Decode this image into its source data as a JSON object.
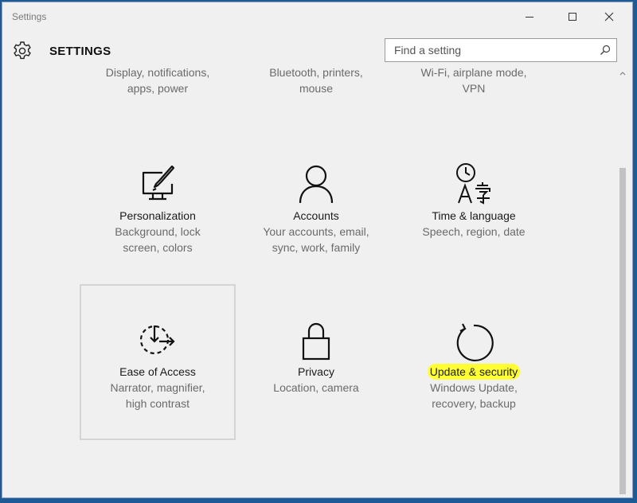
{
  "window": {
    "title": "Settings"
  },
  "header": {
    "title": "SETTINGS",
    "search_placeholder": "Find a setting"
  },
  "top_row": [
    {
      "desc1": "Display, notifications,",
      "desc2": "apps, power"
    },
    {
      "desc1": "Bluetooth, printers,",
      "desc2": "mouse"
    },
    {
      "desc1": "Wi-Fi, airplane mode,",
      "desc2": "VPN"
    }
  ],
  "tiles": [
    {
      "title": "Personalization",
      "desc1": "Background, lock",
      "desc2": "screen, colors",
      "icon": "personalization-icon"
    },
    {
      "title": "Accounts",
      "desc1": "Your accounts, email,",
      "desc2": "sync, work, family",
      "icon": "accounts-icon"
    },
    {
      "title": "Time & language",
      "desc1": "Speech, region, date",
      "desc2": "",
      "icon": "time-language-icon"
    },
    {
      "title": "Ease of Access",
      "desc1": "Narrator, magnifier,",
      "desc2": "high contrast",
      "icon": "ease-of-access-icon"
    },
    {
      "title": "Privacy",
      "desc1": "Location, camera",
      "desc2": "",
      "icon": "privacy-icon"
    },
    {
      "title": "Update & security",
      "desc1": "Windows Update,",
      "desc2": "recovery, backup",
      "icon": "update-security-icon"
    }
  ],
  "colors": {
    "highlight": "#ffff33",
    "window_bg": "#f0f0f0",
    "desktop": "#1e5a96"
  }
}
